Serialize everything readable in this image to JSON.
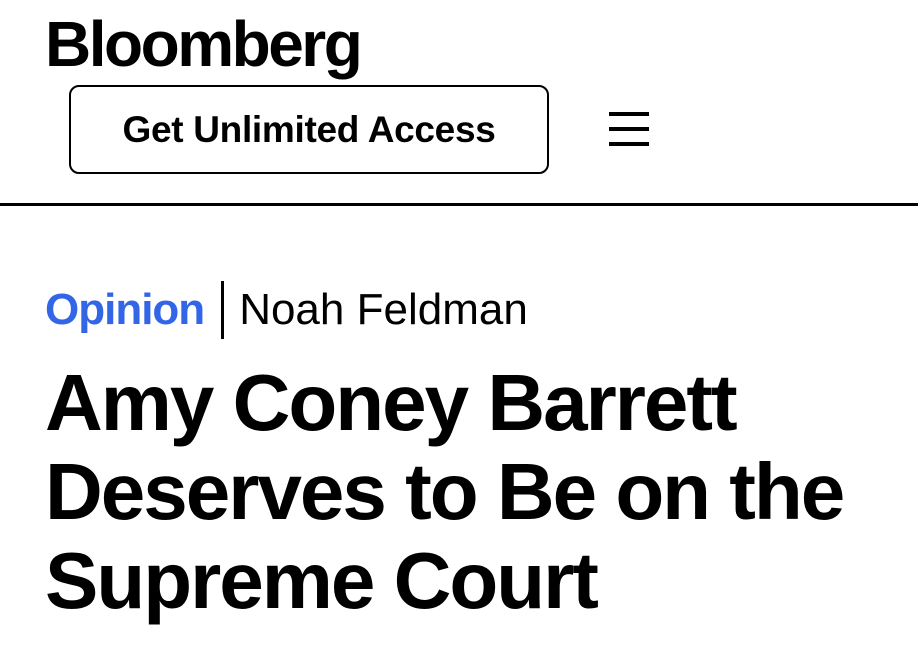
{
  "header": {
    "logo_text": "Bloomberg",
    "access_button_label": "Get Unlimited Access",
    "menu_icon": "hamburger-menu-icon"
  },
  "article": {
    "section": "Opinion",
    "author": "Noah Feldman",
    "headline": "Amy Coney Barrett Deserves to Be on the Supreme Court"
  },
  "colors": {
    "section_accent": "#3366e6",
    "text": "#000000",
    "background": "#ffffff"
  }
}
